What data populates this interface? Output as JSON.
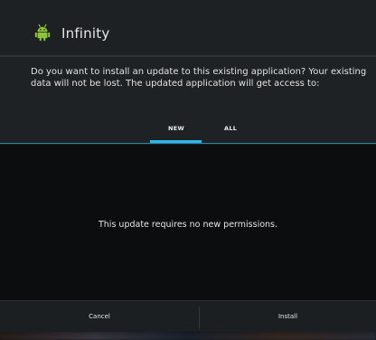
{
  "dialog": {
    "app_title": "Infinity",
    "app_icon": "android-robot-icon",
    "message": "Do you want to install an update to this existing application? Your existing data will not be lost. The updated application will get access to:",
    "tabs": [
      {
        "label": "NEW",
        "selected": true
      },
      {
        "label": "ALL",
        "selected": false
      }
    ],
    "permissions_message": "This update requires no new permissions.",
    "buttons": {
      "cancel": "Cancel",
      "install": "Install"
    }
  },
  "colors": {
    "accent": "#33b5e5",
    "icon_green": "#8bc43a",
    "dialog_bg": "#1f2225",
    "content_bg": "#0c0d0f"
  }
}
